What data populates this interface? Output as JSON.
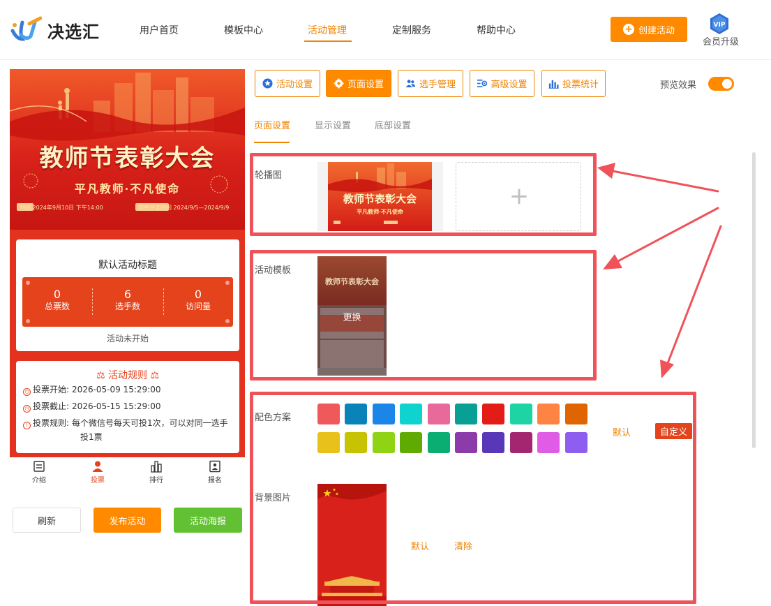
{
  "brand": {
    "name": "决选汇"
  },
  "nav": {
    "items": [
      {
        "label": "用户首页"
      },
      {
        "label": "模板中心"
      },
      {
        "label": "活动管理",
        "active": true
      },
      {
        "label": "定制服务"
      },
      {
        "label": "帮助中心"
      }
    ],
    "create_button": "创建活动",
    "vip_badge": "VIP",
    "vip_label": "会员升级"
  },
  "preview": {
    "banner_title": "教师节表彰大会",
    "banner_subtitle": "平凡教师·不凡使命",
    "banner_info_left": "时间  2024年9月10日 下午14:00",
    "banner_info_right": "网络评选时间  2024/9/5—2024/9/9",
    "activity_title": "默认活动标题",
    "stats": [
      {
        "value": "0",
        "label": "总票数"
      },
      {
        "value": "6",
        "label": "选手数"
      },
      {
        "value": "0",
        "label": "访问量"
      }
    ],
    "activity_status": "活动未开始",
    "rules": {
      "title": "活动规则",
      "vote_start_label": "投票开始:",
      "vote_start": "2026-05-09 15:29:00",
      "vote_end_label": "投票截止:",
      "vote_end": "2026-05-15 15:29:00",
      "vote_rule_label": "投票规则:",
      "vote_rule_line1": "每个微信号每天可投1次，可以对同一选手",
      "vote_rule_line2": "投1票"
    },
    "tabbar": [
      {
        "label": "介绍",
        "icon": "list-icon"
      },
      {
        "label": "投票",
        "icon": "user-icon",
        "active": true
      },
      {
        "label": "排行",
        "icon": "bar-chart-icon"
      },
      {
        "label": "报名",
        "icon": "signup-icon"
      }
    ]
  },
  "actions": {
    "refresh": "刷新",
    "publish": "发布活动",
    "poster": "活动海报"
  },
  "toolbar": {
    "buttons": [
      {
        "label": "活动设置",
        "icon": "star-icon"
      },
      {
        "label": "页面设置",
        "icon": "gear-icon",
        "active": true
      },
      {
        "label": "选手管理",
        "icon": "users-icon"
      },
      {
        "label": "高级设置",
        "icon": "sliders-icon"
      },
      {
        "label": "投票统计",
        "icon": "bar-chart-icon"
      }
    ],
    "preview_label": "预览效果",
    "preview_enabled": true
  },
  "subtabs": [
    {
      "label": "页面设置",
      "active": true
    },
    {
      "label": "显示设置"
    },
    {
      "label": "底部设置"
    }
  ],
  "settings": {
    "carousel_label": "轮播图",
    "carousel_thumb_title": "教师节表彰大会",
    "carousel_thumb_sub": "平凡教师·不凡使命",
    "add_symbol": "+",
    "template_label": "活动模板",
    "template_thumb_title": "教师节表彰大会",
    "template_replace": "更换",
    "color_label": "配色方案",
    "colors": [
      "#f0595b",
      "#0a84b8",
      "#1a86e8",
      "#0fd3cf",
      "#e8699a",
      "#08a095",
      "#e41c18",
      "#1dd4a5",
      "#fe8443",
      "#e06400",
      "#e8c11a",
      "#c8c300",
      "#8ed414",
      "#60ab02",
      "#0aae72",
      "#8c3bab",
      "#5838b8",
      "#a42671",
      "#e05ce6",
      "#8e5ef0"
    ],
    "color_default": "默认",
    "color_custom": "自定义",
    "bg_label": "背景图片",
    "bg_default": "默认",
    "bg_clear": "清除"
  }
}
